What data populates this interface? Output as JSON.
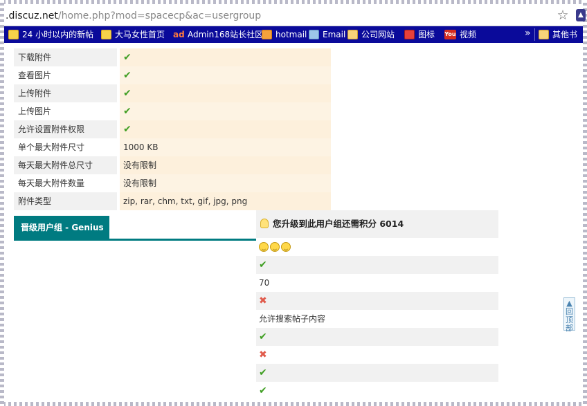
{
  "browser": {
    "url_host": "discuz.net",
    "url_path": "/home.php?mod=spacecp&ac=usergroup",
    "url_prefix": ".",
    "bookmarks": [
      {
        "label": "24 小时以内的新帖",
        "icon": "favorite-icon"
      },
      {
        "label": "大马女性首页",
        "icon": "favorite-icon"
      },
      {
        "label": "Admin168站长社区",
        "icon": "site-logo-icon"
      },
      {
        "label": "hotmail",
        "icon": "mail-icon"
      },
      {
        "label": "Email",
        "icon": "email-icon"
      },
      {
        "label": "公司网站",
        "icon": "folder-icon"
      },
      {
        "label": "图标",
        "icon": "chart-icon"
      },
      {
        "label": "视频",
        "icon": "youtube-icon"
      },
      {
        "label": "其他书",
        "icon": "folder-icon"
      }
    ],
    "overflow_label": "»",
    "youtube_text": "You"
  },
  "permissions": [
    {
      "label": "下载附件",
      "value_type": "check",
      "value": ""
    },
    {
      "label": "查看图片",
      "value_type": "check",
      "value": ""
    },
    {
      "label": "上传附件",
      "value_type": "check",
      "value": ""
    },
    {
      "label": "上传图片",
      "value_type": "check",
      "value": ""
    },
    {
      "label": "允许设置附件权限",
      "value_type": "check",
      "value": ""
    },
    {
      "label": "单个最大附件尺寸",
      "value_type": "text",
      "value": "1000 KB"
    },
    {
      "label": "每天最大附件总尺寸",
      "value_type": "text",
      "value": "没有限制"
    },
    {
      "label": "每天最大附件数量",
      "value_type": "text",
      "value": "没有限制"
    },
    {
      "label": "附件类型",
      "value_type": "text",
      "value": "zip, rar, chm, txt, gif, jpg, png"
    }
  ],
  "group_tab": {
    "label": "晋级用户组 - Genius"
  },
  "upgrade": {
    "heading": "您升级到此用户组还需积分 6014",
    "rows": [
      {
        "type": "smileys",
        "text": ""
      },
      {
        "type": "check",
        "text": ""
      },
      {
        "type": "text",
        "text": "70"
      },
      {
        "type": "cross",
        "text": ""
      },
      {
        "type": "text",
        "text": "允许搜索帖子内容"
      },
      {
        "type": "check",
        "text": ""
      },
      {
        "type": "cross",
        "text": ""
      },
      {
        "type": "check",
        "text": ""
      },
      {
        "type": "check",
        "text": ""
      }
    ]
  },
  "back_to_top": {
    "label": "回顶部"
  },
  "colors": {
    "bookmark_bar": "#0a0a9a",
    "tab": "#007b81",
    "value_bg": "#fdf3e3",
    "check": "#3f9e22",
    "cross": "#e05a4b"
  }
}
